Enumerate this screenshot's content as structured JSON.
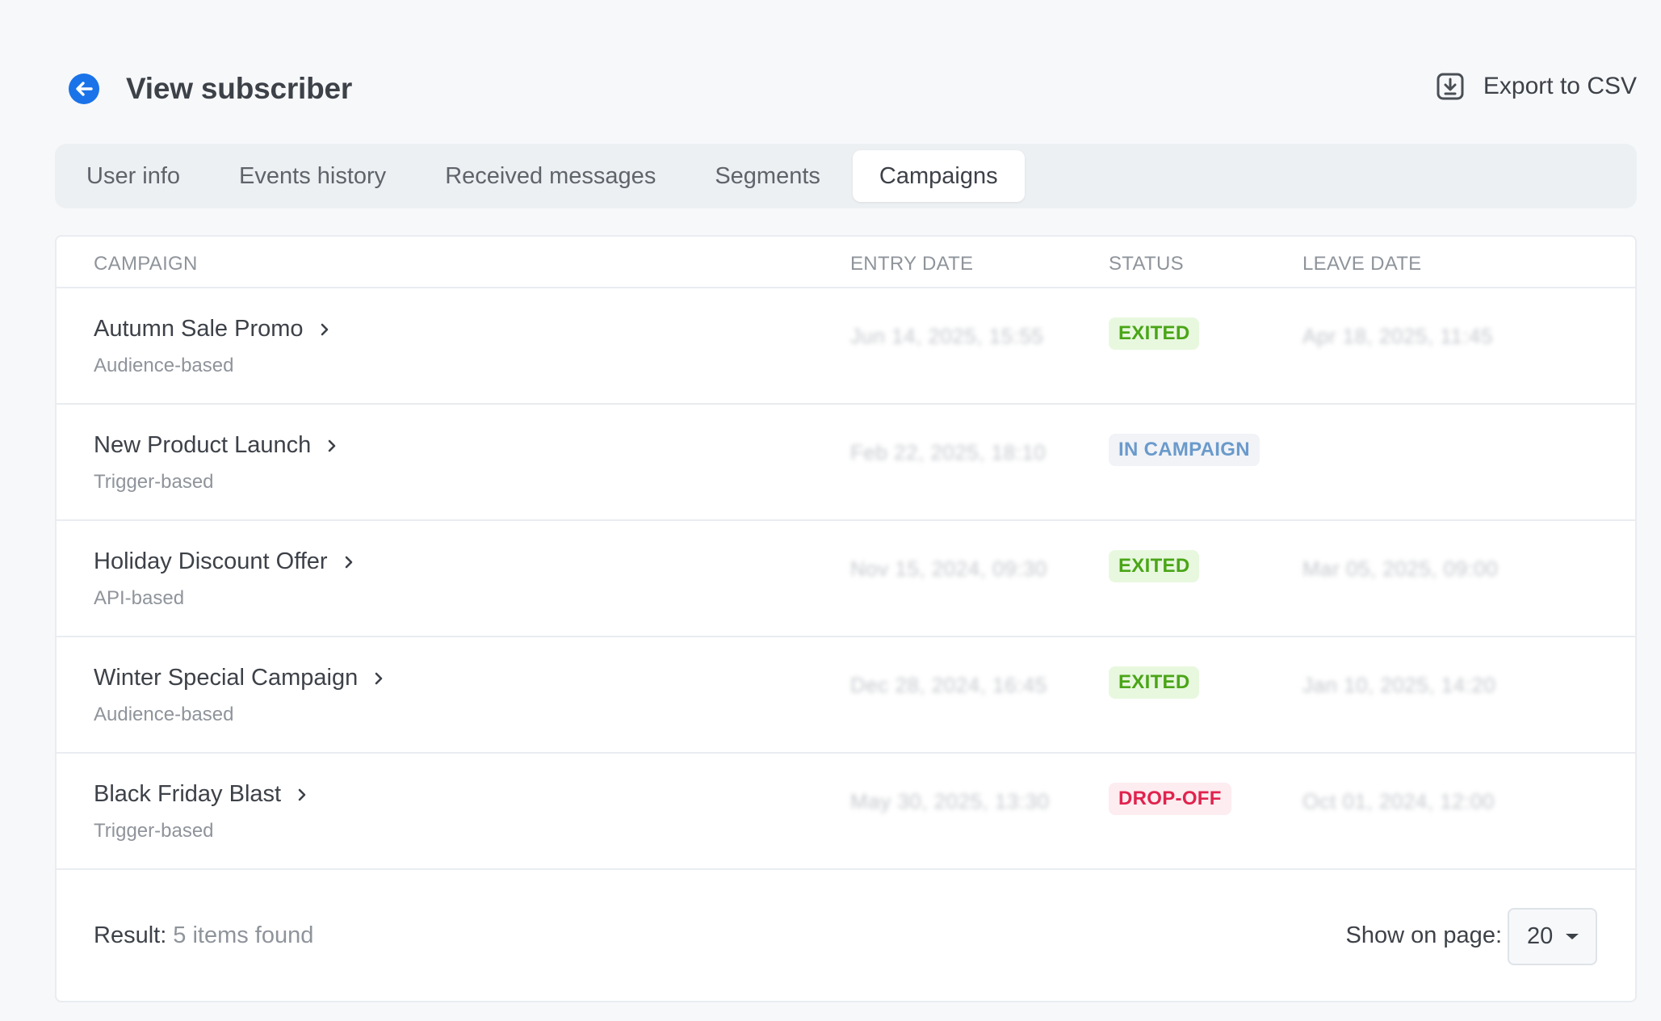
{
  "header": {
    "title": "View subscriber",
    "back_icon": "arrow-left-circle-icon",
    "export_label": "Export to CSV",
    "export_icon": "download-box-icon"
  },
  "tabs": [
    {
      "label": "User info",
      "active": false
    },
    {
      "label": "Events history",
      "active": false
    },
    {
      "label": "Received messages",
      "active": false
    },
    {
      "label": "Segments",
      "active": false
    },
    {
      "label": "Campaigns",
      "active": true
    }
  ],
  "table": {
    "columns": [
      "CAMPAIGN",
      "ENTRY DATE",
      "STATUS",
      "LEAVE DATE"
    ],
    "rows": [
      {
        "name": "Autumn Sale Promo",
        "type": "Audience-based",
        "entry_date": "Jun 14, 2025, 15:55",
        "status": "EXITED",
        "leave_date": "Apr 18, 2025, 11:45"
      },
      {
        "name": "New Product Launch",
        "type": "Trigger-based",
        "entry_date": "Feb 22, 2025, 18:10",
        "status": "IN CAMPAIGN",
        "leave_date": ""
      },
      {
        "name": "Holiday Discount Offer",
        "type": "API-based",
        "entry_date": "Nov 15, 2024, 09:30",
        "status": "EXITED",
        "leave_date": "Mar 05, 2025, 09:00"
      },
      {
        "name": "Winter Special Campaign",
        "type": "Audience-based",
        "entry_date": "Dec 28, 2024, 16:45",
        "status": "EXITED",
        "leave_date": "Jan 10, 2025, 14:20"
      },
      {
        "name": "Black Friday Blast",
        "type": "Trigger-based",
        "entry_date": "May 30, 2025, 13:30",
        "status": "DROP-OFF",
        "leave_date": "Oct 01, 2024, 12:00"
      }
    ]
  },
  "status_colors": {
    "EXITED": {
      "fg": "#4aa517",
      "bg": "#e8f8df"
    },
    "IN CAMPAIGN": {
      "fg": "#6a9acb",
      "bg": "#f1f3f7"
    },
    "DROP-OFF": {
      "fg": "#e0234e",
      "bg": "#fdecf0"
    }
  },
  "footer": {
    "result_label": "Result:",
    "result_value": "5 items found",
    "show_on_page_label": "Show on page:",
    "page_size": "20"
  }
}
